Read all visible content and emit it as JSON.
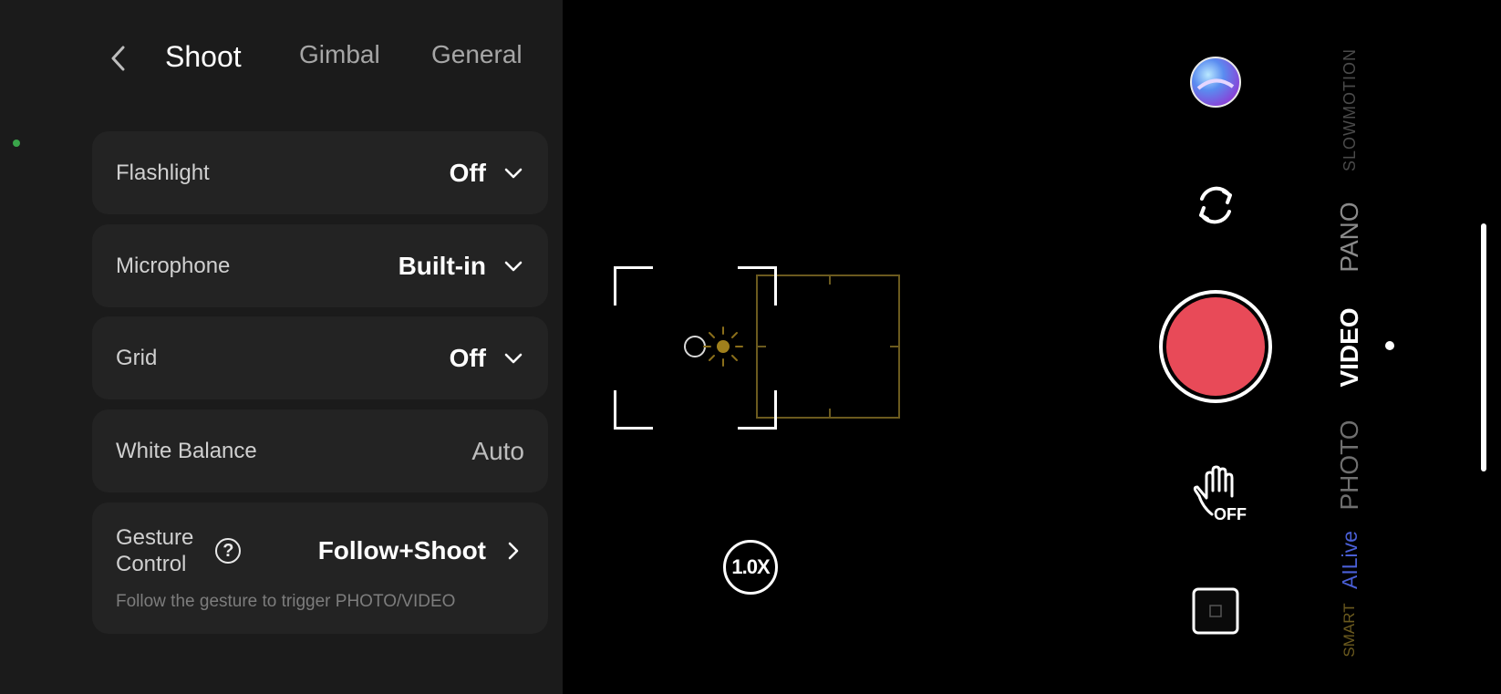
{
  "tabs": [
    {
      "label": "Shoot",
      "active": true
    },
    {
      "label": "Gimbal",
      "active": false
    },
    {
      "label": "General",
      "active": false
    }
  ],
  "settings": {
    "flashlight": {
      "label": "Flashlight",
      "value": "Off"
    },
    "microphone": {
      "label": "Microphone",
      "value": "Built-in"
    },
    "grid": {
      "label": "Grid",
      "value": "Off"
    },
    "white_balance": {
      "label": "White Balance",
      "value": "Auto"
    },
    "gesture": {
      "label_line1": "Gesture",
      "label_line2": "Control",
      "value": "Follow+Shoot",
      "description": "Follow the gesture to trigger PHOTO/VIDEO"
    }
  },
  "camera": {
    "zoom_label": "1.0X",
    "gesture_badge": "OFF",
    "shutter_color": "#e84a58"
  },
  "modes": {
    "slowmotion": "SLOWMOTION",
    "pano": "PANO",
    "video": "VIDEO",
    "photo": "PHOTO",
    "ailive": "AILive",
    "smart": "SMART",
    "selected": "VIDEO"
  },
  "colors": {
    "panel_bg": "#1b1b1b",
    "row_bg": "#232323",
    "accent_gold": "#6b5a1e",
    "ailive_blue": "#4a5fd6",
    "status_green": "#3aa54a"
  },
  "icons": [
    "chevron-left-icon",
    "chevron-down-icon",
    "chevron-right-icon",
    "help-icon",
    "sun-icon",
    "focus-ring-icon",
    "flip-camera-icon",
    "hand-gesture-icon",
    "gallery-icon",
    "avatar-icon"
  ]
}
